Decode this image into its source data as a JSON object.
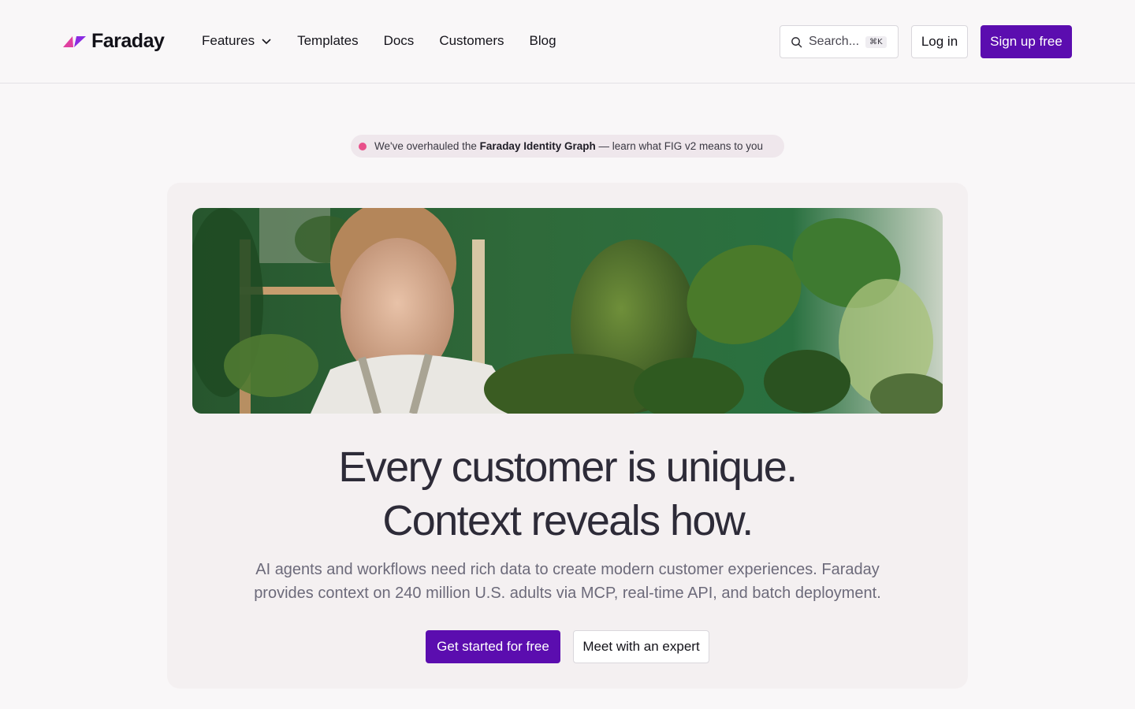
{
  "brand": {
    "name": "Faraday",
    "accent_color": "#5b0daf",
    "logo_colors": [
      "#e040a0",
      "#7b2fd6"
    ]
  },
  "nav": {
    "items": [
      {
        "label": "Features",
        "has_dropdown": true
      },
      {
        "label": "Templates"
      },
      {
        "label": "Docs"
      },
      {
        "label": "Customers"
      },
      {
        "label": "Blog"
      }
    ]
  },
  "search": {
    "placeholder": "Search...",
    "shortcut": "⌘K",
    "icon": "search-icon"
  },
  "header_actions": {
    "login_label": "Log in",
    "signup_label": "Sign up free"
  },
  "announcement": {
    "prefix": "We've overhauled the ",
    "highlight": "Faraday Identity Graph",
    "suffix": " — learn what FIG v2 means to you",
    "dot_color": "#e8508a"
  },
  "hero": {
    "image_alt": "Woman tending to potted plants in a green room",
    "headline_line1": "Every customer is unique.",
    "headline_line2": "Context reveals how.",
    "subhead_line1": "AI agents and workflows need rich data to create modern customer experiences. Faraday",
    "subhead_line2": "provides context on 240 million U.S. adults via MCP, real-time API, and batch deployment.",
    "primary_cta": "Get started for free",
    "secondary_cta": "Meet with an expert"
  }
}
